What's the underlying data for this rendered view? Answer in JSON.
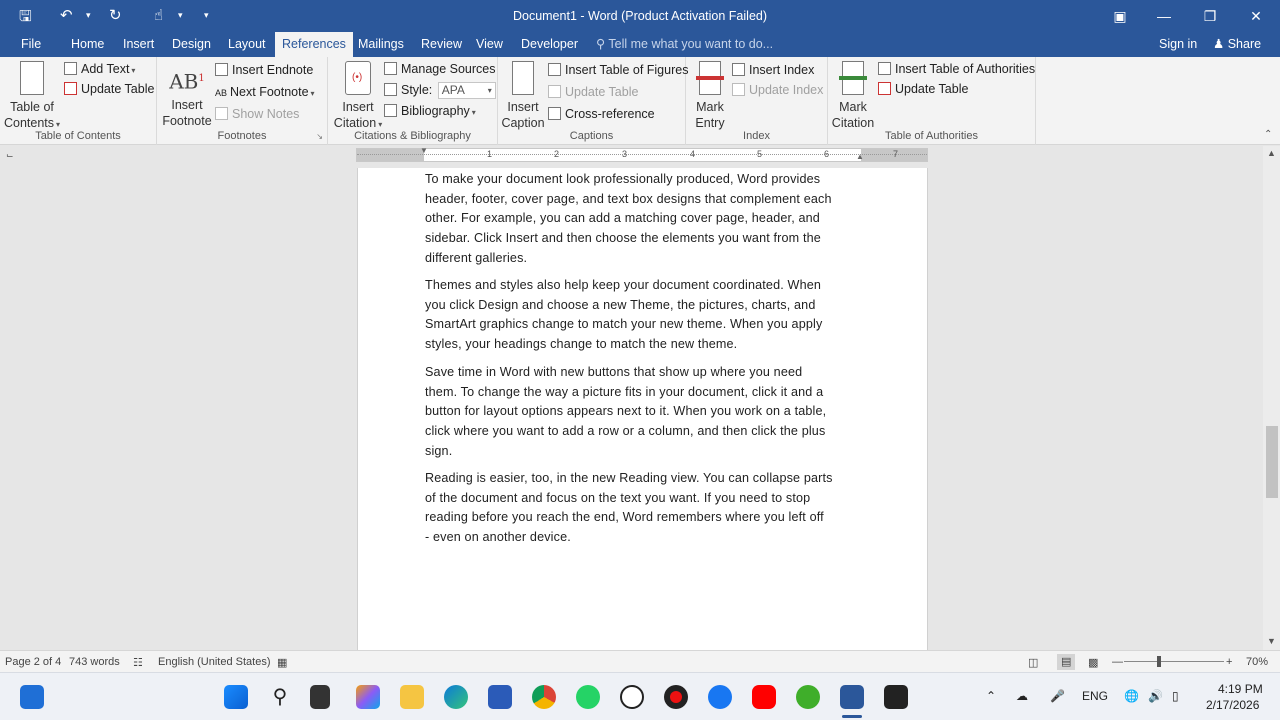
{
  "window": {
    "title": "Document1 - Word (Product Activation Failed)"
  },
  "tabs": [
    "File",
    "Home",
    "Insert",
    "Design",
    "Layout",
    "References",
    "Mailings",
    "Review",
    "View",
    "Developer"
  ],
  "active_tab": "References",
  "tell_me": "Tell me what you want to do...",
  "account": {
    "sign_in": "Sign in",
    "share": "Share"
  },
  "ribbon": {
    "toc": {
      "label": "Table of Contents",
      "big": "Table of Contents",
      "add_text": "Add Text",
      "update_table": "Update Table"
    },
    "footnotes": {
      "label": "Footnotes",
      "insert_footnote": "Insert Footnote",
      "insert_endnote": "Insert Endnote",
      "next_footnote": "Next Footnote",
      "show_notes": "Show Notes"
    },
    "citations": {
      "label": "Citations & Bibliography",
      "insert_citation": "Insert Citation",
      "manage_sources": "Manage Sources",
      "style_label": "Style:",
      "style_value": "APA",
      "bibliography": "Bibliography"
    },
    "captions": {
      "label": "Captions",
      "insert_caption": "Insert Caption",
      "insert_table_of_figures": "Insert Table of Figures",
      "update_table": "Update Table",
      "cross_reference": "Cross-reference"
    },
    "index": {
      "label": "Index",
      "mark_entry": "Mark Entry",
      "insert_index": "Insert Index",
      "update_index": "Update Index"
    },
    "toa": {
      "label": "Table of Authorities",
      "mark_citation": "Mark Citation",
      "insert_toa": "Insert Table of Authorities",
      "update_table": "Update Table"
    }
  },
  "ruler_numbers": [
    "1",
    "2",
    "3",
    "4",
    "5",
    "6",
    "7"
  ],
  "document": {
    "paragraphs": [
      [
        "To make your document look professionally produced, Word provides",
        "header, footer, cover page, and text box designs that complement each",
        "other. For example, you can add a matching cover page, header, and",
        "sidebar. Click Insert and then choose the elements you want from the",
        "different galleries."
      ],
      [
        "Themes and styles also help keep your document coordinated. When",
        "you click Design and choose a new Theme, the pictures, charts, and",
        "SmartArt graphics change to match your new theme. When you apply",
        "styles, your headings change to match the new theme."
      ],
      [
        "Save time in Word with new buttons that show up where you need",
        "them. To change the way a picture fits in your document, click it and a",
        "button for layout options appears next to it. When you work on a table,",
        "click where you want to add a row or a column, and then click the plus",
        "sign."
      ],
      [
        "Reading is easier, too, in the new Reading view. You can collapse parts",
        "of the document and focus on the text you want. If you need to stop",
        "reading before you reach the end, Word remembers where you left off",
        "- even on another device."
      ]
    ]
  },
  "status": {
    "page": "Page 2 of 4",
    "words": "743 words",
    "language": "English (United States)",
    "zoom": "70%",
    "zoom_fraction": 0.35
  },
  "taskbar": {
    "lang": "ENG",
    "time": "4:19 PM",
    "date": "2/17/2026"
  },
  "colors": {
    "titlebar": "#2b579a",
    "ribbon": "#f3f3f3"
  }
}
